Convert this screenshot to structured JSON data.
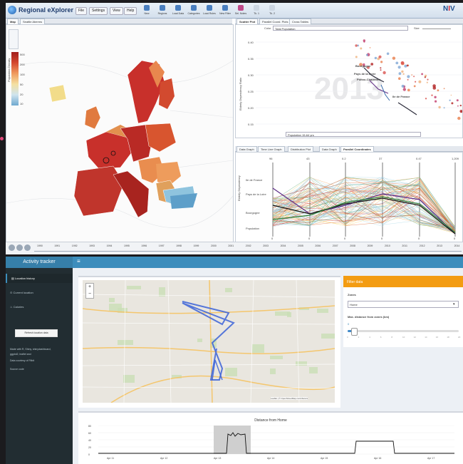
{
  "regional_explorer": {
    "title": "Regional eXplorer",
    "menus": [
      "File",
      "Settings",
      "View",
      "Help"
    ],
    "toolbar": [
      "New",
      "Regions",
      "Load Data",
      "Categories",
      "Load Rules",
      "New Filter",
      "Sel. Notes",
      "Tk. 1",
      "Tk. 2"
    ],
    "brand": {
      "prefix": "N",
      "suffix": "V"
    },
    "map_tabs": [
      "Map",
      "Seattle Aberms"
    ],
    "legend_title": "Population Density",
    "legend_values": [
      "500",
      "200",
      "100",
      "50",
      "20",
      "10"
    ],
    "scatter_tabs": [
      "Scatter Plot",
      "Parallel Coord. Plots",
      "Cross Tables"
    ],
    "scatter_color_label": "Color",
    "scatter_color_value": "Total Population",
    "scatter_size_label": "Size",
    "scatter_year": "2013",
    "scatter_y_label": "Elderly Dependency Ratio",
    "scatter_x_value": "Population 15-64 yrs",
    "scatter_y_ticks": [
      "0.40",
      "0.35",
      "0.30",
      "0.25",
      "0.20",
      "0.15"
    ],
    "scatter_labels": [
      {
        "text": "Bourgogne"
      },
      {
        "text": "Pays de la Loire"
      },
      {
        "text": "Poitou-Charentes"
      },
      {
        "text": "Ile de France"
      }
    ],
    "pc_tabs": [
      "Data Graph",
      "Time Line Graph",
      "Distribution Plot",
      "Data Graph",
      "Parallel Coordinates"
    ],
    "pc_axes": [
      "Density Population 0..Inf",
      "Population 0-14",
      "Population 65+",
      "Population 65+",
      "Population 65+ Elderly Dependency",
      "Population 15-64"
    ],
    "pc_axis_top": [
      "96",
      "43",
      "0.2",
      "37",
      "0.47",
      "1,209"
    ],
    "pc_axis_bottom": [
      "0",
      "0",
      "0",
      "0",
      "0",
      "0"
    ],
    "pc_labels": [
      "Ile de France",
      "Pays de la Loire",
      "Bourgogne",
      "Population"
    ],
    "pc_y_label": "Elderly Dependency",
    "timeline_years": [
      "1990",
      "1991",
      "1992",
      "1993",
      "1994",
      "1995",
      "1996",
      "1997",
      "1998",
      "1999",
      "2000",
      "2001",
      "2002",
      "2003",
      "2004",
      "2005",
      "2006",
      "2007",
      "2008",
      "2009",
      "2010",
      "2011",
      "2012",
      "2013",
      "2014"
    ]
  },
  "activity_tracker": {
    "title": "Activity tracker",
    "menu_toggle": "≡",
    "sidebar_items": [
      "Location history",
      "Current location",
      "Calories"
    ],
    "refresh_button": "Refresh location data",
    "notes": [
      "Made with R, Shiny, shinydashboard,",
      "ggplot2, leaflet and",
      "Data courtesy of Fitbit",
      "Source code"
    ],
    "filter_title": "Filter data",
    "zones_label": "Zones",
    "zones_value": "Home",
    "distance_label": "Max. distance from zones (km)",
    "distance_min": "0",
    "distance_value": 1.0,
    "distance_ticks": [
      "0",
      "1",
      "2",
      "3",
      "4",
      "5",
      "6",
      "7",
      "8",
      "9",
      "10",
      "11",
      "12",
      "13",
      "14",
      "15",
      "16",
      "17",
      "18",
      "19",
      "20"
    ],
    "map_attrib": "Leaflet | © OpenStreetMap contributors",
    "chart_title": "Distance from Home",
    "chart_y_ticks": [
      "80",
      "60",
      "40",
      "20",
      "0"
    ],
    "chart_x_ticks": [
      "Apr 11",
      "Apr 12",
      "Apr 13",
      "Apr 14",
      "Apr 15",
      "Apr 16",
      "Apr 17"
    ]
  },
  "colors": {
    "dashboard_blue": "#3c8dbc",
    "sidebar_dark": "#222d32",
    "filter_orange": "#f39c12",
    "map_red": "#c8302b"
  }
}
